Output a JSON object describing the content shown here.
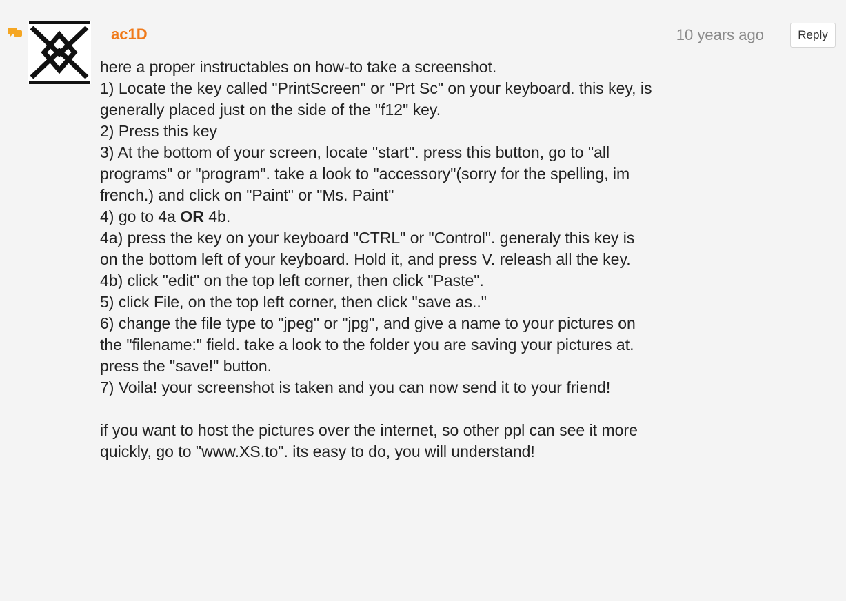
{
  "comment": {
    "author": "ac1D",
    "timestamp": "10 years ago",
    "reply_label": "Reply",
    "icons": {
      "comment_icon": "speech-bubble-icon",
      "avatar": "diamond-x-logo"
    },
    "colors": {
      "author": "#f07a1a",
      "comment_icon": "#f5a623",
      "timestamp": "#8a8a8a"
    },
    "body": {
      "intro": "here a proper instructables on how-to take a screenshot.",
      "step1_a": "1) Locate the key called \"PrintScreen\" or \"Prt Sc\" on your keyboard. this key, is",
      "step1_b": "generally placed just on the side of the \"f12\" key.",
      "step2": "2) Press this key",
      "step3_a": "3) At the bottom of your screen, locate \"start\". press this button, go to \"all",
      "step3_b": "programs\" or \"program\". take a look to \"accessory\"(sorry for the spelling, im",
      "step3_c": "french.) and click on \"Paint\" or \"Ms. Paint\"",
      "step4_prefix": "4) go to 4a ",
      "step4_bold": "OR",
      "step4_suffix": " 4b.",
      "step4a_a": "4a) press the key on your keyboard \"CTRL\" or \"Control\". generaly this key is",
      "step4a_b": "on the bottom left of your keyboard. Hold it, and press V. releash all the key.",
      "step4b": "4b) click \"edit\" on the top left corner, then click \"Paste\".",
      "step5": "5) click File, on the top left corner, then click \"save as..\"",
      "step6_a": "6) change the file type to \"jpeg\" or \"jpg\", and give a name to your pictures on",
      "step6_b": "the \"filename:\" field. take a look to the folder you are saving your pictures at.",
      "step6_c": "press the \"save!\" button.",
      "step7": "7) Voila! your screenshot is taken and you can now send it to your friend!",
      "outro_a": "if you want to host the pictures over the internet, so other ppl can see it more",
      "outro_b": "quickly, go to \"www.XS.to\". its easy to do, you will understand!"
    }
  }
}
